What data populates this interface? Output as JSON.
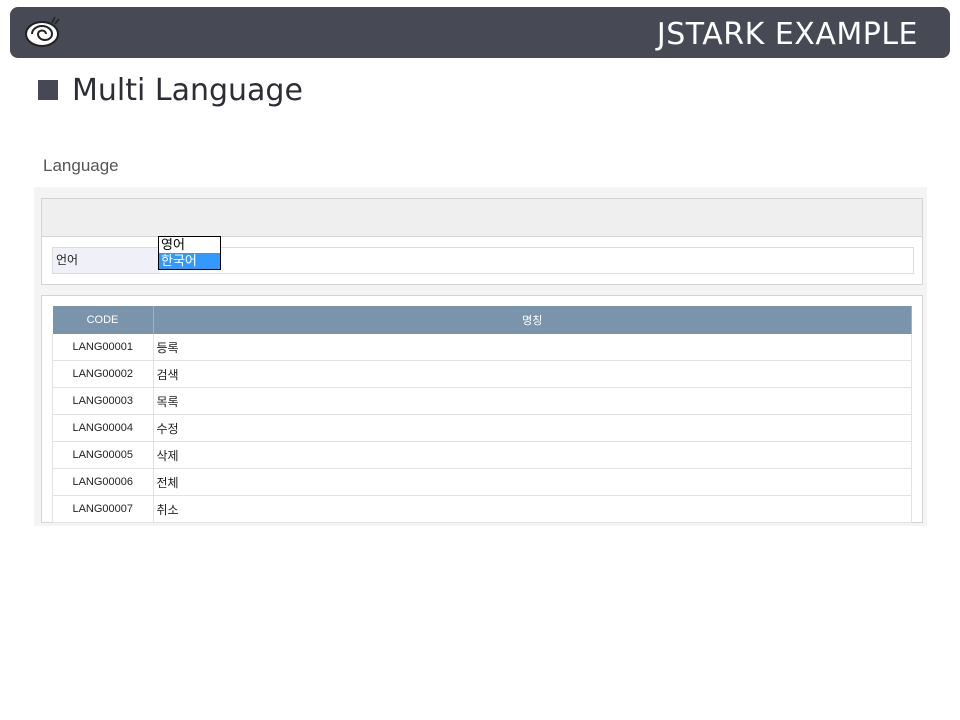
{
  "header": {
    "brand": "JSTARK EXAMPLE",
    "logo_icon": "snail-logo-icon"
  },
  "slide": {
    "title": "Multi Language"
  },
  "section": {
    "label": "Language"
  },
  "form": {
    "field_label": "언어",
    "options": [
      "영어",
      "한국어"
    ],
    "selected": "한국어"
  },
  "grid": {
    "columns": [
      "CODE",
      "명칭"
    ],
    "rows": [
      {
        "code": "LANG00001",
        "name": "등록"
      },
      {
        "code": "LANG00002",
        "name": "검색"
      },
      {
        "code": "LANG00003",
        "name": "목록"
      },
      {
        "code": "LANG00004",
        "name": "수정"
      },
      {
        "code": "LANG00005",
        "name": "삭제"
      },
      {
        "code": "LANG00006",
        "name": "전체"
      },
      {
        "code": "LANG00007",
        "name": "취소"
      }
    ]
  },
  "colors": {
    "topbar": "#474955",
    "grid_header": "#7994ab",
    "selected_option": "#3399ff"
  }
}
